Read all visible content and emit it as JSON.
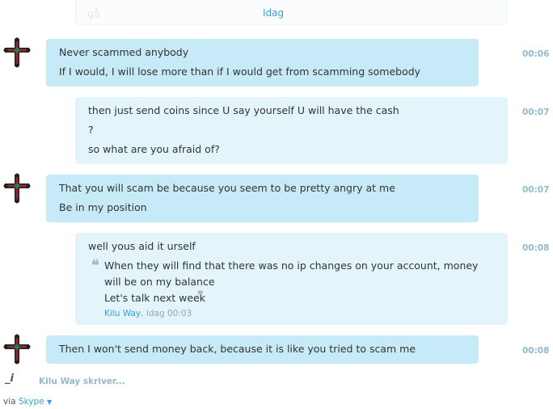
{
  "top_card": {
    "faded_text": "gå",
    "author": "Idag"
  },
  "messages": [
    {
      "side": "in",
      "lines": [
        "Never scammed anybody",
        "If I would, I will lose more than if I would get from scamming somebody"
      ],
      "time": "00:06"
    },
    {
      "side": "out",
      "lines": [
        "then just send coins since U say yourself U will have the cash",
        "?",
        "so what are you afraid of?"
      ],
      "time": "00:07"
    },
    {
      "side": "in",
      "lines": [
        "That you will scam be because you seem to be pretty angry at me",
        "Be in my position"
      ],
      "time": "00:07"
    },
    {
      "side": "out",
      "lines": [
        "well yous aid it urself"
      ],
      "time": "00:08",
      "quote": {
        "open_mark": "❝",
        "close_mark": "❞",
        "lines": [
          "When they will find that there was no ip changes on your account, money",
          "will be on my balance",
          "Let's talk next week"
        ],
        "author": "Kilu Way",
        "meta": ", Idag 00:03"
      }
    },
    {
      "side": "in",
      "lines": [
        "Then I won't send money back, because it is like you tried to scam me"
      ],
      "time": "00:08"
    }
  ],
  "typing": {
    "icon_text": "_i",
    "text": "Kilu Way skriver..."
  },
  "footer": {
    "via": "via",
    "service": "Skype"
  },
  "colors": {
    "incoming": "#c7eaf8",
    "outgoing": "#e3f4fb",
    "time": "#93b9cf",
    "link": "#3a9fd6"
  }
}
